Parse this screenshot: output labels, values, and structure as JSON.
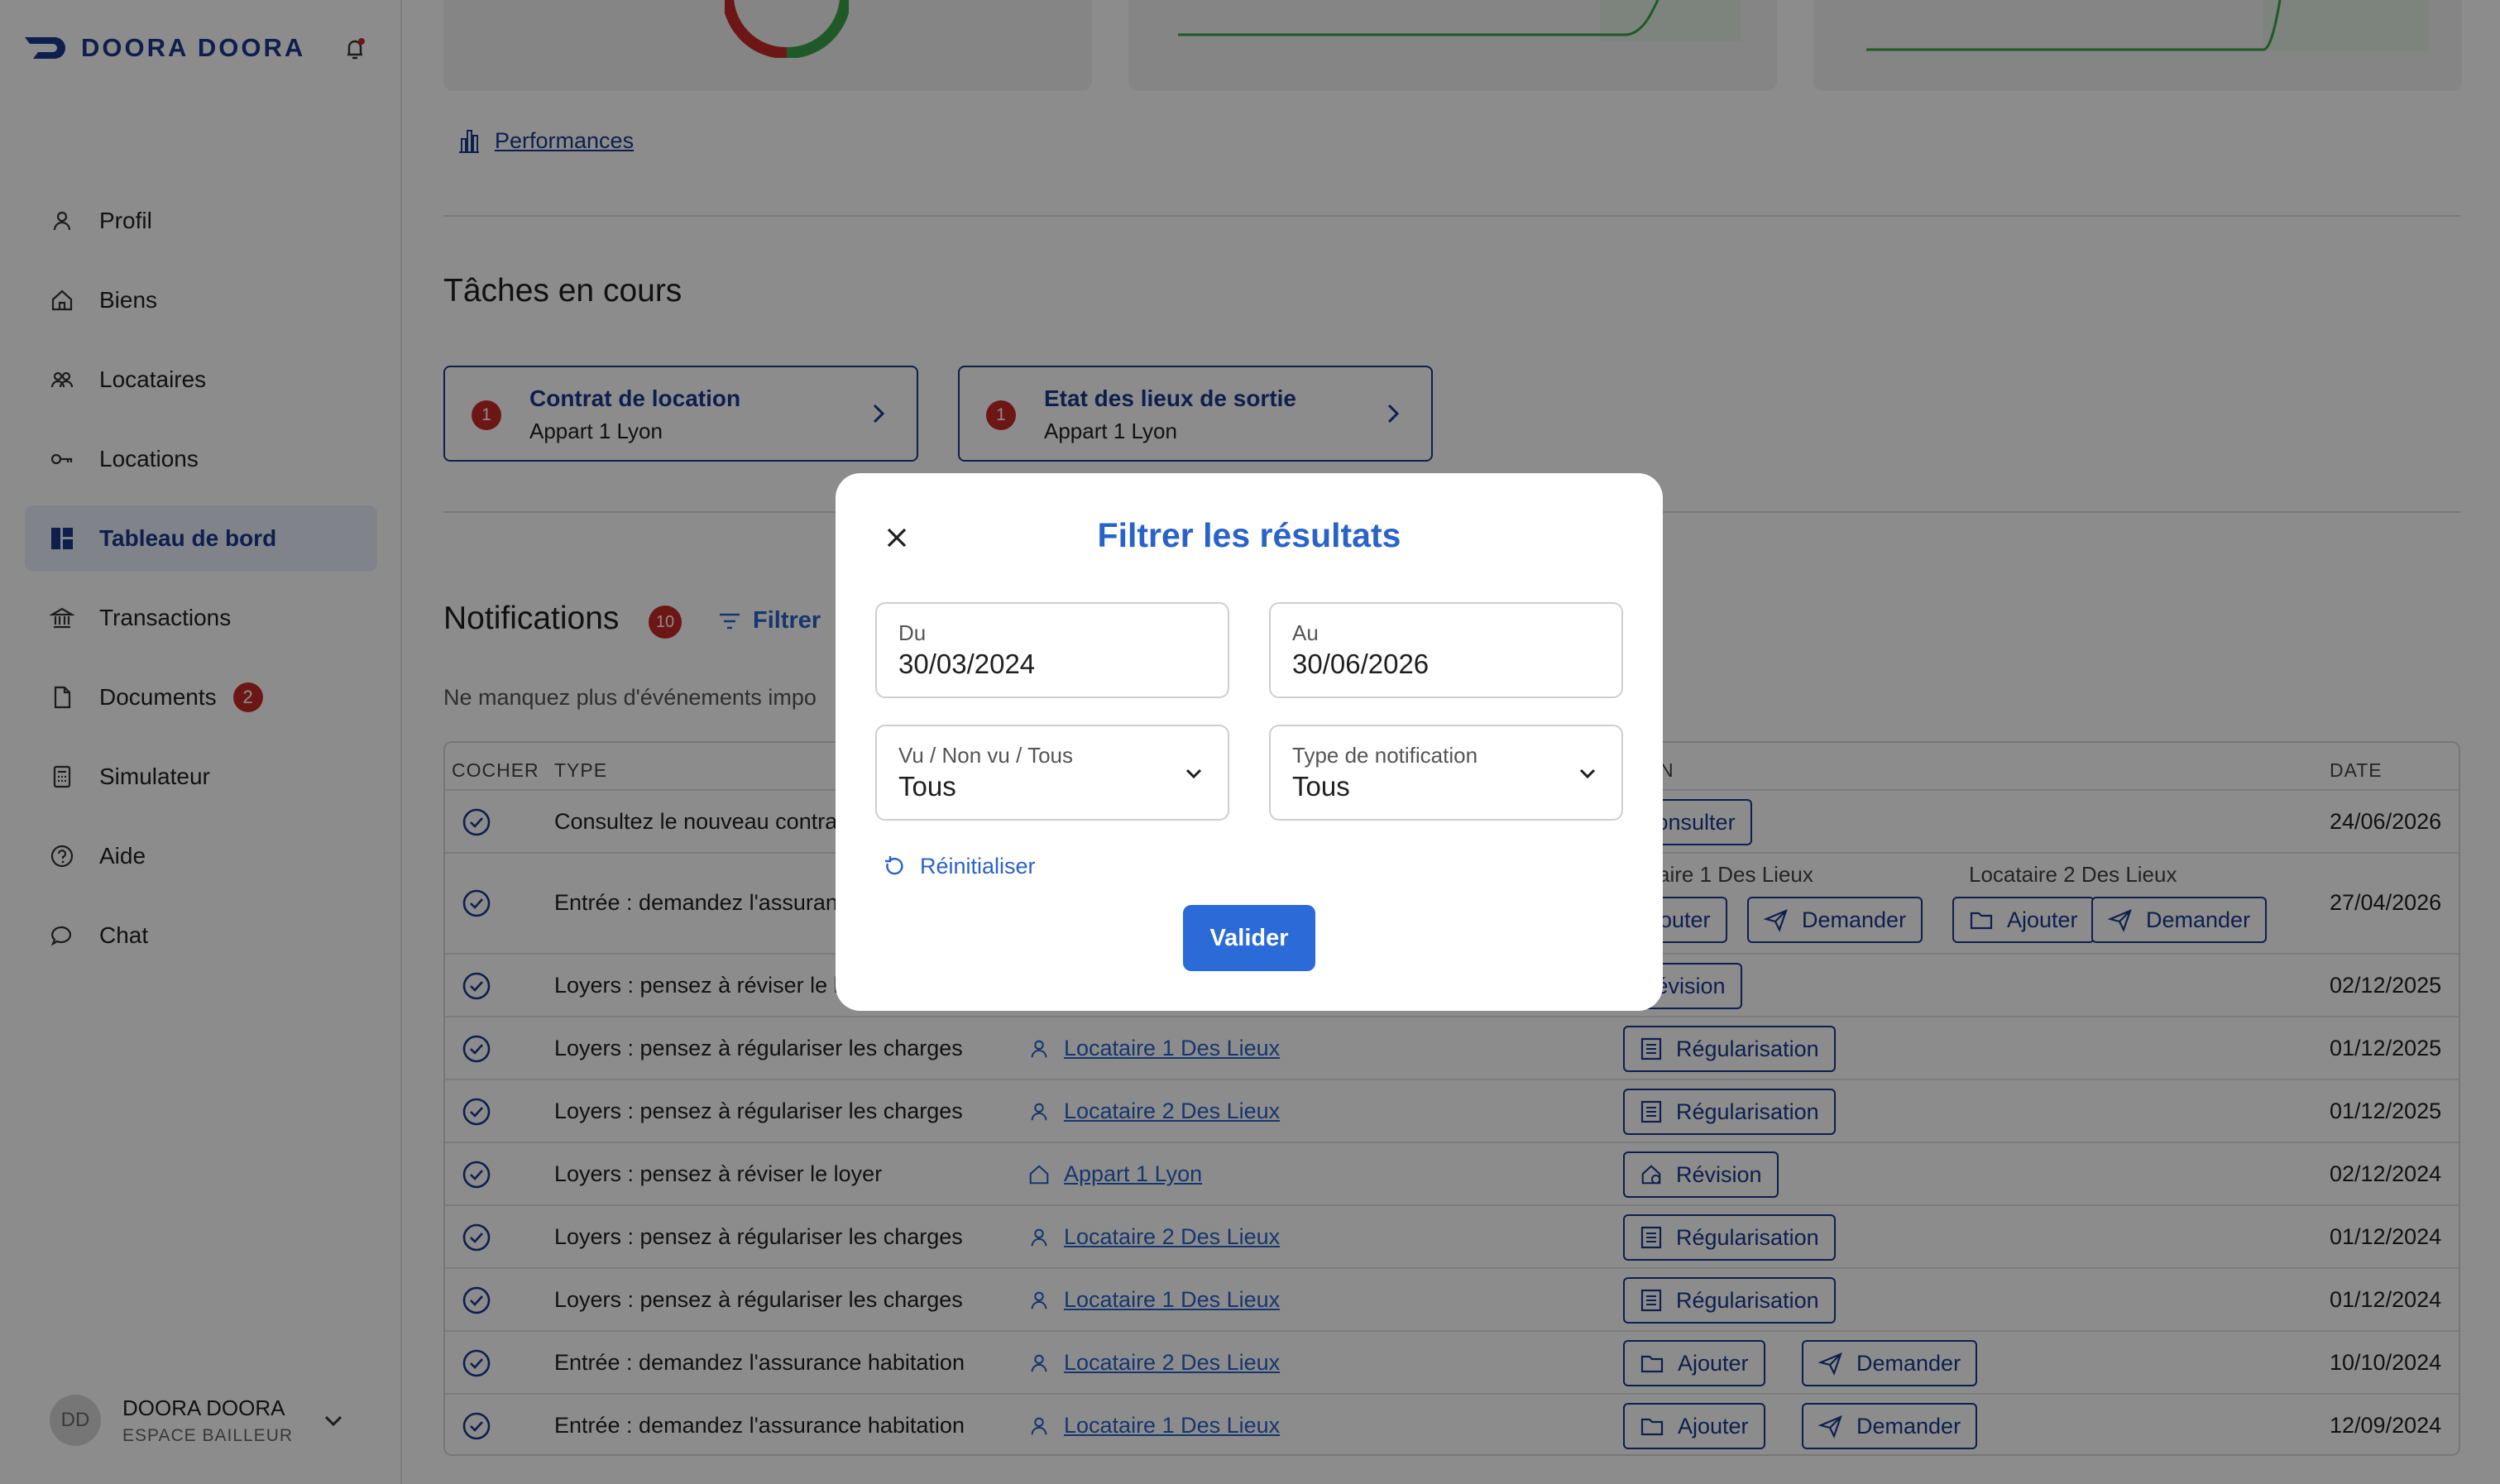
{
  "brand": {
    "name": "DOORA DOORA"
  },
  "sidebar": {
    "items": [
      {
        "label": "Profil",
        "icon": "user-icon"
      },
      {
        "label": "Biens",
        "icon": "home-icon"
      },
      {
        "label": "Locataires",
        "icon": "users-icon"
      },
      {
        "label": "Locations",
        "icon": "key-icon"
      },
      {
        "label": "Tableau de bord",
        "icon": "dashboard-icon",
        "active": true
      },
      {
        "label": "Transactions",
        "icon": "bank-icon"
      },
      {
        "label": "Documents",
        "icon": "document-icon",
        "badge": "2"
      },
      {
        "label": "Simulateur",
        "icon": "calculator-icon"
      },
      {
        "label": "Aide",
        "icon": "help-icon"
      },
      {
        "label": "Chat",
        "icon": "chat-icon"
      }
    ],
    "user": {
      "initials": "DD",
      "name": "DOORA DOORA",
      "role": "ESPACE BAILLEUR"
    }
  },
  "main": {
    "performances_link": "Performances",
    "tasks": {
      "title": "Tâches en cours",
      "items": [
        {
          "count": "1",
          "title": "Contrat de location",
          "subtitle": "Appart 1 Lyon"
        },
        {
          "count": "1",
          "title": "Etat des lieux de sortie",
          "subtitle": "Appart 1 Lyon"
        }
      ]
    },
    "notifications": {
      "title": "Notifications",
      "count": "10",
      "filter_label": "Filtrer",
      "description": "Ne manquez plus d'événements impo",
      "columns": {
        "check": "COCHER",
        "type": "TYPE",
        "action": "N",
        "date": "DATE"
      },
      "rows": [
        {
          "type": "Consultez le nouveau contra",
          "date": "24/06/2026",
          "actions": [
            "Consulter"
          ]
        },
        {
          "type": "Entrée : demandez l'assuran",
          "date": "27/04/2026",
          "sub_a": "aire 1 Des Lieux",
          "sub_b": "Locataire 2 Des Lieux",
          "actions": [
            "Ajouter",
            "Demander",
            "Ajouter",
            "Demander"
          ]
        },
        {
          "type": "Loyers : pensez à réviser le l",
          "date": "02/12/2025",
          "actions": [
            "Révision"
          ]
        },
        {
          "type": "Loyers : pensez à régulariser les charges",
          "link": "Locataire 1 Des Lieux",
          "date": "01/12/2025",
          "actions": [
            "Régularisation"
          ]
        },
        {
          "type": "Loyers : pensez à régulariser les charges",
          "link": "Locataire 2 Des Lieux",
          "date": "01/12/2025",
          "actions": [
            "Régularisation"
          ]
        },
        {
          "type": "Loyers : pensez à réviser le loyer",
          "link": "Appart 1 Lyon",
          "date": "02/12/2024",
          "actions": [
            "Révision"
          ]
        },
        {
          "type": "Loyers : pensez à régulariser les charges",
          "link": "Locataire 2 Des Lieux",
          "date": "01/12/2024",
          "actions": [
            "Régularisation"
          ]
        },
        {
          "type": "Loyers : pensez à régulariser les charges",
          "link": "Locataire 1 Des Lieux",
          "date": "01/12/2024",
          "actions": [
            "Régularisation"
          ]
        },
        {
          "type": "Entrée : demandez l'assurance habitation",
          "link": "Locataire 2 Des Lieux",
          "date": "10/10/2024",
          "actions": [
            "Ajouter",
            "Demander"
          ]
        },
        {
          "type": "Entrée : demandez l'assurance habitation",
          "link": "Locataire 1 Des Lieux",
          "date": "12/09/2024",
          "actions": [
            "Ajouter",
            "Demander"
          ]
        }
      ]
    }
  },
  "modal": {
    "title": "Filtrer les résultats",
    "from": {
      "label": "Du",
      "value": "30/03/2024"
    },
    "to": {
      "label": "Au",
      "value": "30/06/2026"
    },
    "seen": {
      "label": "Vu / Non vu / Tous",
      "value": "Tous"
    },
    "type": {
      "label": "Type de notification",
      "value": "Tous"
    },
    "reset_label": "Réinitialiser",
    "validate_label": "Valider"
  },
  "colors": {
    "primary": "#1b3a8f",
    "accent": "#2a63c8",
    "badge": "#c62828",
    "chart_green": "#3aa34a",
    "chart_red": "#c62828"
  }
}
